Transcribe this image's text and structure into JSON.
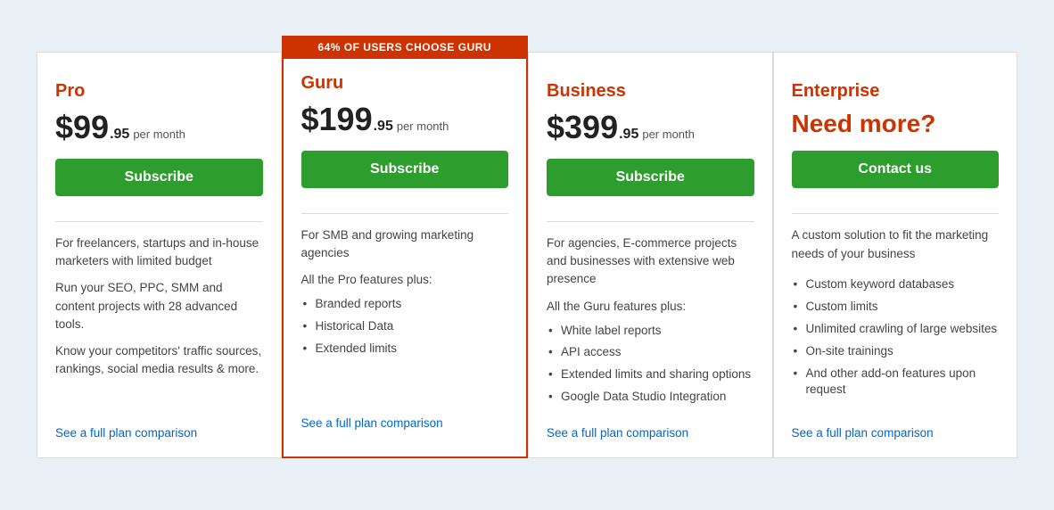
{
  "plans": [
    {
      "id": "pro",
      "name": "Pro",
      "price_main": "$99",
      "price_cents": ".95",
      "price_period": "per month",
      "button_label": "Subscribe",
      "description_lines": [
        "For freelancers, startups and in-house marketers with limited budget",
        "Run your SEO, PPC, SMM and content projects with 28 advanced tools.",
        "Know your competitors' traffic sources, rankings, social media results & more."
      ],
      "features_intro": null,
      "features": [],
      "see_full_link": "See a full plan comparison",
      "is_guru": false,
      "banner": null
    },
    {
      "id": "guru",
      "name": "Guru",
      "price_main": "$199",
      "price_cents": ".95",
      "price_period": "per month",
      "button_label": "Subscribe",
      "description_lines": [
        "For SMB and growing marketing agencies"
      ],
      "features_intro": "All the Pro features plus:",
      "features": [
        "Branded reports",
        "Historical Data",
        "Extended limits"
      ],
      "see_full_link": "See a full plan comparison",
      "is_guru": true,
      "banner": "64% OF USERS CHOOSE GURU"
    },
    {
      "id": "business",
      "name": "Business",
      "price_main": "$399",
      "price_cents": ".95",
      "price_period": "per month",
      "button_label": "Subscribe",
      "description_lines": [
        "For agencies, E-commerce projects and businesses with extensive web presence"
      ],
      "features_intro": "All the Guru features plus:",
      "features": [
        "White label reports",
        "API access",
        "Extended limits and sharing options",
        "Google Data Studio Integration"
      ],
      "see_full_link": "See a full plan comparison",
      "is_guru": false,
      "banner": null
    },
    {
      "id": "enterprise",
      "name": "Enterprise",
      "need_more": "Need more?",
      "button_label": "Contact us",
      "description_lines": [
        "A custom solution to fit the marketing needs of your business"
      ],
      "features_intro": null,
      "features": [
        "Custom keyword databases",
        "Custom limits",
        "Unlimited crawling of large websites",
        "On-site trainings",
        "And other add-on features upon request"
      ],
      "see_full_link": "See a full plan comparison",
      "is_guru": false,
      "banner": null
    }
  ]
}
